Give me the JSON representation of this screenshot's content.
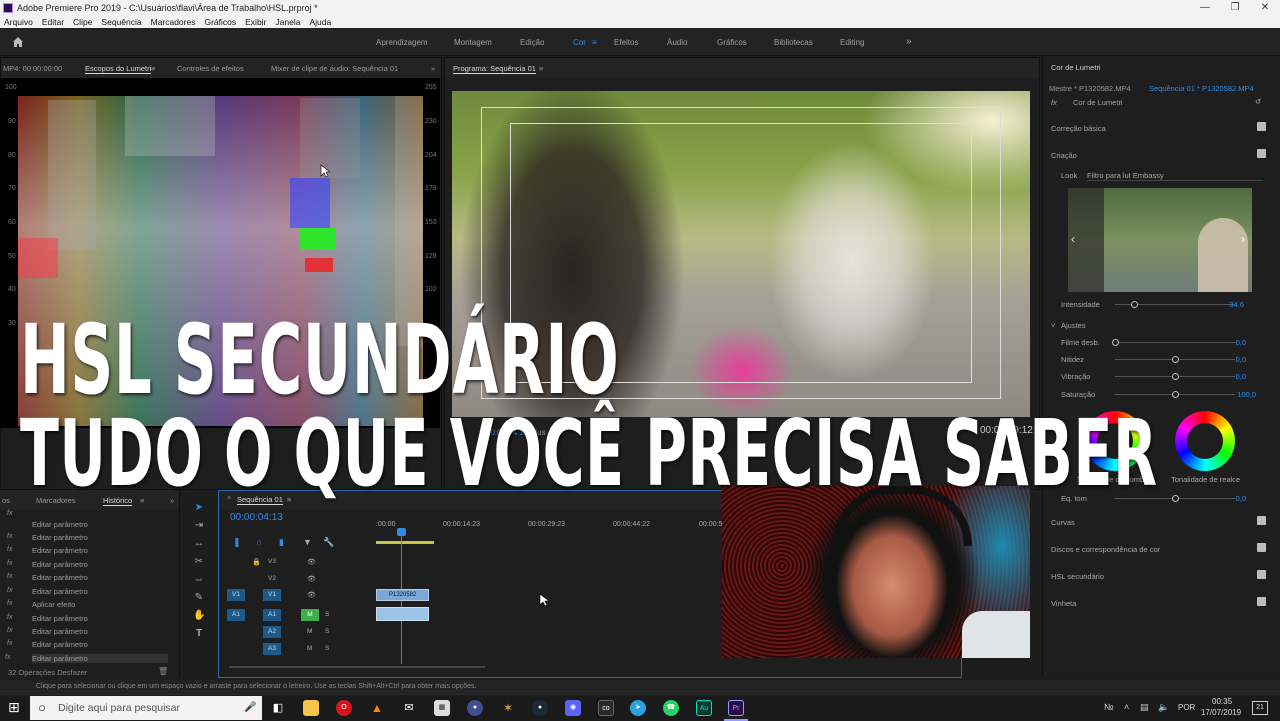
{
  "window": {
    "title": "Adobe Premiere Pro 2019 - C:\\Usuários\\flavi\\Área de Trabalho\\HSL.prproj *"
  },
  "menu": [
    "Arquivo",
    "Editar",
    "Clipe",
    "Sequência",
    "Marcadores",
    "Gráficos",
    "Exibir",
    "Janela",
    "Ajuda"
  ],
  "workspaces": [
    "Aprendizagem",
    "Montagem",
    "Edição",
    "Cor",
    "Efeitos",
    "Áudio",
    "Gráficos",
    "Bibliotecas",
    "Editing"
  ],
  "workspace_active": "Cor",
  "source_panel": {
    "timecode": "MP4: 00:00:00:00",
    "tabs": [
      "Escopos do Lumetri",
      "Controles de efeitos",
      "Mixer de clipe de áudio: Sequência 01"
    ],
    "left_scale": [
      "100",
      "90",
      "80",
      "70",
      "60",
      "50",
      "40",
      "30"
    ],
    "right_scale": [
      "255",
      "230",
      "204",
      "179",
      "153",
      "128",
      "102"
    ]
  },
  "program": {
    "title": "Programa: Sequência 01",
    "timecode_in": "00:00:04:13",
    "fit": "Ajus",
    "duration": "00:00:09:12"
  },
  "lumetri": {
    "title": "Cor de Lumetri",
    "master_clip": "Mestre * P1320582.MP4",
    "sequence_clip": "Sequência 01 * P1320582.MP4",
    "effect": "Cor de Lumetri",
    "sections": {
      "basic": "Correção básica",
      "creative": "Criação",
      "curves": "Curvas",
      "wheels": "Discos e correspondência de cor",
      "hsl": "HSL secundário",
      "vignette": "Vinheta"
    },
    "look_label": "Look",
    "look_value": "Filtro para lut Embassy",
    "intensity_label": "Intensidade",
    "intensity_value": "34,6",
    "adjustments": "Ajustes",
    "params": [
      {
        "label": "Filme desb.",
        "value": "0,0"
      },
      {
        "label": "Nitidez",
        "value": "0,0"
      },
      {
        "label": "Vibração",
        "value": "0,0"
      },
      {
        "label": "Saturação",
        "value": "100,0"
      }
    ],
    "shadow_tint": "Tonalidade da sombra",
    "highlight_tint": "Tonalidade de realce",
    "tone_balance_label": "Eq. tom",
    "tone_balance_value": "0,0"
  },
  "history": {
    "tabs": [
      "os",
      "Marcadores",
      "Histórico"
    ],
    "items": [
      "Editar parâmetro",
      "Editar parâmetro",
      "Editar parâmetro",
      "Editar parâmetro",
      "Editar parâmetro",
      "Editar parâmetro",
      "Aplicar efeito",
      "Editar parâmetro",
      "Editar parâmetro",
      "Editar parâmetro",
      "Editar parâmetro",
      "Editar parâmetro"
    ],
    "footer": "32 Operações Desfazer"
  },
  "timeline": {
    "tab": "Sequência 01",
    "timecode": "00:00:04:13",
    "ruler": [
      ":00:00",
      "00:00:14:23",
      "00:00:29:23",
      "00:00:44:22",
      "00:00:5"
    ],
    "video_tracks": [
      "V3",
      "V2",
      "V1"
    ],
    "audio_tracks": [
      "A1",
      "A2",
      "A3"
    ],
    "clip_name": "P1320582"
  },
  "overlay": {
    "line1": "HSL SECUNDÁRIO",
    "line2": "TUDO O QUE VOCÊ PRECISA SABER"
  },
  "status": "Clique para selecionar ou clique em um espaço vazio e arraste para selecionar o letreiro. Use as teclas Shift+Alt+Ctrl para obter mais opções.",
  "taskbar": {
    "search_placeholder": "Digite aqui para pesquisar",
    "lang": "POR",
    "time": "00:35",
    "date": "17/07/2019",
    "notif_count": "21"
  },
  "colors": {
    "accent": "#2d8ceb",
    "premiere": "#9999ff",
    "audition": "#00e4bb"
  }
}
